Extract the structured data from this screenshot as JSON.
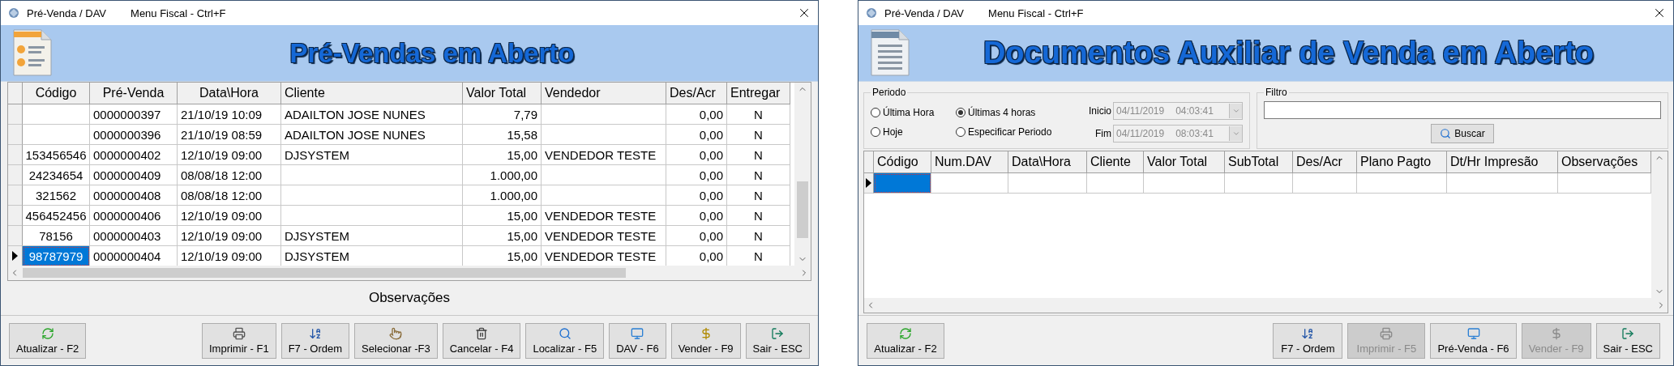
{
  "windows": [
    {
      "title": "Pré-Venda / DAV",
      "menu": "Menu Fiscal - Ctrl+F",
      "heading": "Pré-Vendas em Aberto",
      "table": {
        "columns": [
          "Código",
          "Pré-Venda",
          "Data\\Hora",
          "Cliente",
          "Valor Total",
          "Vendedor",
          "Des/Acr",
          "Entregar"
        ],
        "rows": [
          {
            "selected": false,
            "cells": [
              null,
              "0000000397",
              "21/10/19 10:09",
              "ADAILTON JOSE NUNES",
              "7,79",
              null,
              "0,00",
              "N"
            ]
          },
          {
            "selected": false,
            "cells": [
              null,
              "0000000396",
              "21/10/19 08:59",
              "ADAILTON JOSE NUNES",
              "15,58",
              null,
              "0,00",
              "N"
            ]
          },
          {
            "selected": false,
            "cells": [
              "153456546",
              "0000000402",
              "12/10/19 09:00",
              "DJSYSTEM",
              "15,00",
              "VENDEDOR TESTE",
              "0,00",
              "N"
            ]
          },
          {
            "selected": false,
            "cells": [
              "24234654",
              "0000000409",
              "08/08/18 12:00",
              null,
              "1.000,00",
              null,
              "0,00",
              "N"
            ]
          },
          {
            "selected": false,
            "cells": [
              "321562",
              "0000000408",
              "08/08/18 12:00",
              null,
              "1.000,00",
              null,
              "0,00",
              "N"
            ]
          },
          {
            "selected": false,
            "cells": [
              "456452456",
              "0000000406",
              "12/10/19 09:00",
              null,
              "15,00",
              "VENDEDOR TESTE",
              "0,00",
              "N"
            ]
          },
          {
            "selected": false,
            "cells": [
              "78156",
              "0000000403",
              "12/10/19 09:00",
              "DJSYSTEM",
              "15,00",
              "VENDEDOR TESTE",
              "0,00",
              "N"
            ]
          },
          {
            "selected": true,
            "cells": [
              "98787979",
              "0000000404",
              "12/10/19 09:00",
              "DJSYSTEM",
              "15,00",
              "VENDEDOR TESTE",
              "0,00",
              "N"
            ]
          }
        ]
      },
      "observations_label": "Observações",
      "buttons": [
        {
          "kind": "refresh",
          "label": "Atualizar - F2",
          "disabled": false
        },
        {
          "kind": "print",
          "label": "Imprimir - F1",
          "disabled": false
        },
        {
          "kind": "sort",
          "label": "F7 - Ordem",
          "disabled": false
        },
        {
          "kind": "select",
          "label": "Selecionar -F3",
          "disabled": false
        },
        {
          "kind": "delete",
          "label": "Cancelar - F4",
          "disabled": false
        },
        {
          "kind": "find",
          "label": "Localizar - F5",
          "disabled": false
        },
        {
          "kind": "screens",
          "label": "DAV - F6",
          "disabled": false
        },
        {
          "kind": "money",
          "label": "Vender - F9",
          "disabled": false
        },
        {
          "kind": "exit",
          "label": "Sair - ESC",
          "disabled": false
        }
      ]
    },
    {
      "title": "Pré-Venda / DAV",
      "menu": "Menu Fiscal - Ctrl+F",
      "heading": "Documentos Auxiliar de Venda em Aberto",
      "filter": {
        "period": {
          "label": "Periodo",
          "options": [
            {
              "label": "Última Hora",
              "selected": false
            },
            {
              "label": "Últimas 4 horas",
              "selected": true
            },
            {
              "label": "Hoje",
              "selected": false
            },
            {
              "label": "Especificar Periodo",
              "selected": false
            }
          ],
          "start": {
            "label": "Inicio",
            "date": "04/11/2019",
            "time": "04:03:41",
            "disabled": true
          },
          "end": {
            "label": "Fim",
            "date": "04/11/2019",
            "time": "08:03:41",
            "disabled": true
          }
        },
        "search": {
          "label": "Filtro",
          "button": "Buscar"
        }
      },
      "table": {
        "columns": [
          "Código",
          "Num.DAV",
          "Data\\Hora",
          "Cliente",
          "Valor Total",
          "SubTotal",
          "Des/Acr",
          "Plano Pagto",
          "Dt/Hr Impresão",
          "Observações"
        ],
        "rows": [
          {
            "selected": true,
            "cells": []
          }
        ]
      },
      "buttons": [
        {
          "kind": "refresh",
          "label": "Atualizar - F2",
          "disabled": false
        },
        {
          "kind": "sort",
          "label": "F7 - Ordem",
          "disabled": false
        },
        {
          "kind": "print",
          "label": "Imprimir - F5",
          "disabled": true
        },
        {
          "kind": "screens",
          "label": "Pré-Venda - F6",
          "disabled": false
        },
        {
          "kind": "money",
          "label": "Vender - F9",
          "disabled": true
        },
        {
          "kind": "exit",
          "label": "Sair - ESC",
          "disabled": false
        }
      ]
    }
  ]
}
